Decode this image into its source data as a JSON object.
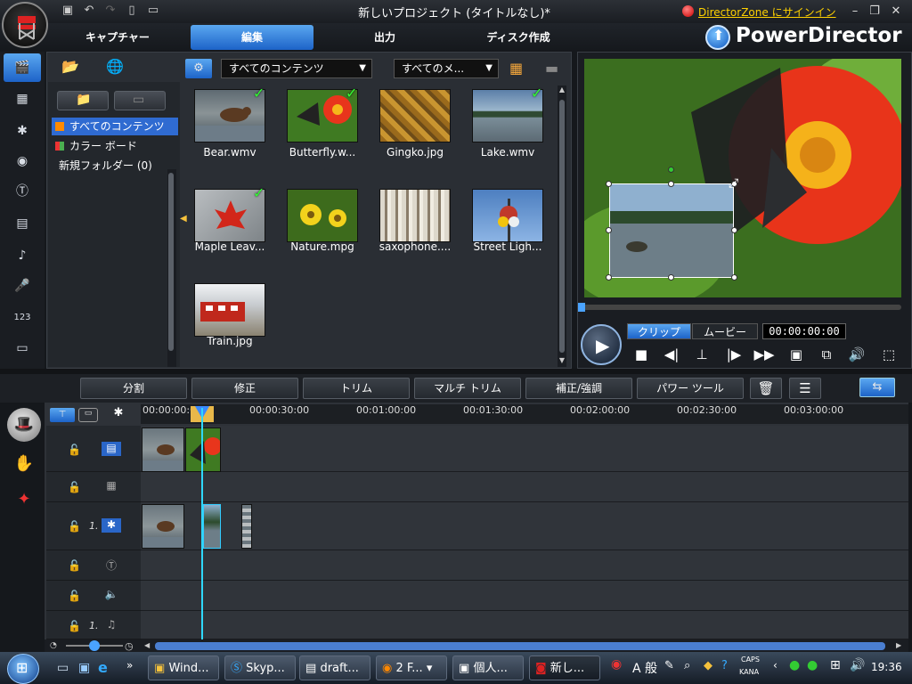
{
  "window": {
    "title": "新しいプロジェクト (タイトルなし)*",
    "directorzone_link": "DirectorZone にサインイン",
    "brand": "PowerDirector"
  },
  "main_tabs": [
    {
      "label": "キャプチャー",
      "active": false
    },
    {
      "label": "編集",
      "active": true
    },
    {
      "label": "出力",
      "active": false
    },
    {
      "label": "ディスク作成",
      "active": false
    }
  ],
  "library": {
    "content_filter": "すべてのコンテンツ",
    "media_filter": "すべてのメ...",
    "tree": [
      {
        "label": "すべてのコンテンツ",
        "selected": true,
        "swatch": "#ff8a00"
      },
      {
        "label": "カラー ボード",
        "selected": false,
        "swatch": "#4caf50"
      },
      {
        "label": "新規フォルダー (0)",
        "selected": false,
        "swatch": ""
      }
    ],
    "items": [
      {
        "name": "Bear.wmv",
        "checked": true
      },
      {
        "name": "Butterfly.w...",
        "checked": true
      },
      {
        "name": "Gingko.jpg",
        "checked": false
      },
      {
        "name": "Lake.wmv",
        "checked": true
      },
      {
        "name": "Maple Leav...",
        "checked": true
      },
      {
        "name": "Nature.mpg",
        "checked": false
      },
      {
        "name": "saxophone....",
        "checked": false
      },
      {
        "name": "Street Ligh...",
        "checked": false
      },
      {
        "name": "Train.jpg",
        "checked": false
      }
    ]
  },
  "preview": {
    "mode_clip": "クリップ",
    "mode_movie": "ムービー",
    "timecode": "00:00:00:00"
  },
  "toolbar": {
    "split": "分割",
    "modify": "修正",
    "trim": "トリム",
    "multi_trim": "マルチ トリム",
    "fix_enhance": "補正/強調",
    "power_tools": "パワー ツール"
  },
  "timeline": {
    "ruler": [
      "00:00:00:00",
      "00:00:30:00",
      "00:01:00:00",
      "00:01:30:00",
      "00:02:00:00",
      "00:02:30:00",
      "00:03:00:00"
    ],
    "track_numbers": {
      "pip": "1.",
      "music": "1."
    }
  },
  "taskbar": {
    "tasks": [
      "Wind...",
      "Skyp...",
      "draft...",
      "2 F...",
      "個人...",
      "新し..."
    ],
    "ime": "A 般",
    "caps": "CAPS",
    "kana": "KANA",
    "clock": "19:36"
  }
}
